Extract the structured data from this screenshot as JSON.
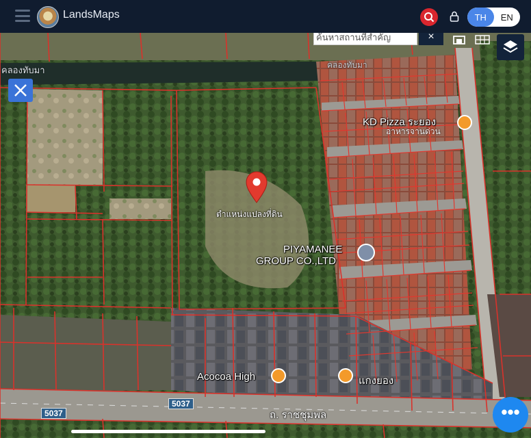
{
  "header": {
    "app_name": "LandsMaps",
    "lang_th": "TH",
    "lang_en": "EN"
  },
  "map": {
    "search_placeholder": "ค้นหาสถานที่สำคัญ",
    "search_close": "×",
    "parcel_label": "ตำแหน่งแปลงที่ดิน",
    "canal_left": "คลองทับมา",
    "canal_right": "คลองทับมา",
    "pois": {
      "kd_pizza": "KD Pizza ระยอง",
      "kd_pizza_sub": "อาหารจานด่วน",
      "piyamanee_1": "PIYAMANEE",
      "piyamanee_2": "GROUP CO.,LTD",
      "acocoa": "Acocoa High",
      "kaeng": "แกงยอง"
    },
    "road_shield_1": "5037",
    "road_shield_2": "5037",
    "road_name": "ถ. ราชชุมพล",
    "fab_label": "•••"
  },
  "colors": {
    "accent": "#4a86e8",
    "parcel_line": "#d9322b",
    "search_red": "#d9262e"
  },
  "icons": {
    "menu": "hamburger-icon",
    "search": "search-icon",
    "lock": "lock-icon",
    "layers": "layers-icon",
    "tools": "ruler-tools-icon",
    "marker": "map-pin-icon"
  }
}
